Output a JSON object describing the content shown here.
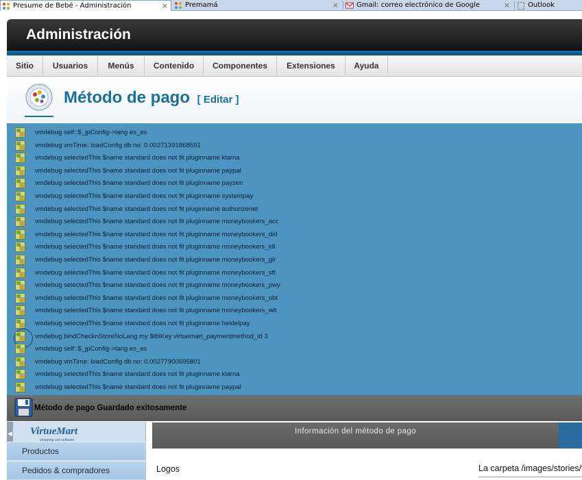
{
  "browser": {
    "tabs": [
      {
        "title": "Presume de Bebé - Administración",
        "close": "×",
        "icon": "joomla-icon"
      },
      {
        "title": "Premamá",
        "close": "×",
        "icon": "joomla-icon"
      },
      {
        "title": "Gmail: correo electrónico de Google",
        "close": "×",
        "icon": "gmail-icon"
      },
      {
        "title": "Outlook",
        "icon": "page-icon"
      }
    ]
  },
  "header": {
    "title": "Administración"
  },
  "menu": {
    "items": [
      "Sitio",
      "Usuarios",
      "Menús",
      "Contenido",
      "Componentes",
      "Extensiones",
      "Ayuda"
    ]
  },
  "page_title": {
    "main": "Método de pago",
    "edit": "[ Editar ]"
  },
  "debug": {
    "messages": [
      "vmdebug self::$_jpConfig->lang es_es",
      "vmdebug vmTime: loadConfig db no: 0.00271391868591",
      "vmdebug selectedThis $name standard does not fit pluginname klarna",
      "vmdebug selectedThis $name standard does not fit pluginname paypal",
      "vmdebug selectedThis $name standard does not fit pluginname payzen",
      "vmdebug selectedThis $name standard does not fit pluginname systempay",
      "vmdebug selectedThis $name standard does not fit pluginname authorizenet",
      "vmdebug selectedThis $name standard does not fit pluginname moneybookers_acc",
      "vmdebug selectedThis $name standard does not fit pluginname moneybookers_did",
      "vmdebug selectedThis $name standard does not fit pluginname moneybookers_idl",
      "vmdebug selectedThis $name standard does not fit pluginname moneybookers_gir",
      "vmdebug selectedThis $name standard does not fit pluginname moneybookers_sft",
      "vmdebug selectedThis $name standard does not fit pluginname moneybookers_pwy",
      "vmdebug selectedThis $name standard does not fit pluginname moneybookers_obt",
      "vmdebug selectedThis $name standard does not fit pluginname moneybookers_wlt",
      "vmdebug selectedThis $name standard does not fit pluginname heidelpay",
      "vmdebug bindChecknStoreNoLang my $tblKey virtuemart_paymentmethod_id 3",
      "vmdebug self::$_jpConfig->lang es_es",
      "vmdebug vmTime: loadConfig db no: 0.00277900695801",
      "vmdebug selectedThis $name standard does not fit pluginname klarna",
      "vmdebug selectedThis $name standard does not fit pluginname paypal"
    ]
  },
  "save_message": "Método de pago Guardado exitosamente",
  "sidebar": {
    "logo": "VirtueMart",
    "logo_tagline": "shopping cart software",
    "links": [
      "Productos",
      "Pedidos & compradores"
    ]
  },
  "info": {
    "header": "Información del método de pago",
    "logos_label": "Logos",
    "folder_text": "La carpeta /images/stories/virtuemart/payment/"
  },
  "colors": {
    "debug_bg": "#4d94c1",
    "title_blue": "#1a6fa1",
    "header_dark": "#141414"
  }
}
